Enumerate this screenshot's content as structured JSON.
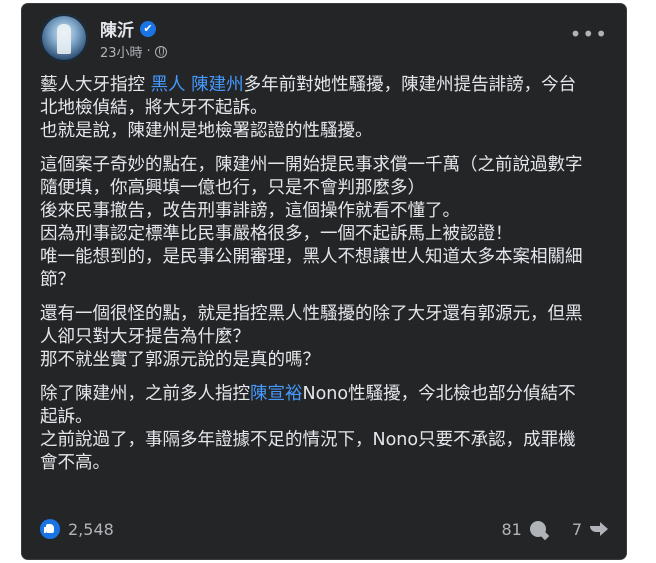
{
  "post": {
    "author": "陳沂",
    "verified_mark": "✔",
    "time": "23小時",
    "dot": "·",
    "more_label": "•••"
  },
  "content": {
    "p1": {
      "l1_a": "藝人大牙指控 ",
      "l1_link1": "黑人",
      "l1_sp": " ",
      "l1_link2": "陳建州",
      "l1_b": "多年前對她性騷擾，陳建州提告誹謗，今台",
      "l2": "北地檢偵結，將大牙不起訴。",
      "l3": "也就是說，陳建州是地檢署認證的性騷擾。"
    },
    "p2": {
      "l1": "這個案子奇妙的點在，陳建州一開始提民事求償一千萬（之前說過數字",
      "l2": "隨便填，你高興填一億也行，只是不會判那麼多）",
      "l3": "後來民事撤告，改告刑事誹謗，這個操作就看不懂了。",
      "l4": "因為刑事認定標準比民事嚴格很多，一個不起訴馬上被認證！",
      "l5": "唯一能想到的，是民事公開審理，黑人不想讓世人知道太多本案相關細",
      "l6": "節？"
    },
    "p3": {
      "l1": "還有一個很怪的點，就是指控黑人性騷擾的除了大牙還有郭源元，但黑",
      "l2": "人卻只對大牙提告為什麼？",
      "l3": "那不就坐實了郭源元說的是真的嗎？"
    },
    "p4": {
      "l1_a": "除了陳建州，之前多人指控",
      "l1_link": "陳宣裕",
      "l1_b": "Nono性騷擾，今北檢也部分偵結不",
      "l2": "起訴。",
      "l3": "之前說過了，事隔多年證據不足的情況下，Nono只要不承認，成罪機",
      "l4": "會不高。"
    }
  },
  "stats": {
    "likes": "2,548",
    "comments": "81",
    "shares": "7"
  },
  "colors": {
    "card_bg": "#242526",
    "text": "#e4e6eb",
    "muted": "#b0b3b8",
    "link": "#4599ff",
    "accent": "#1b74e4"
  }
}
